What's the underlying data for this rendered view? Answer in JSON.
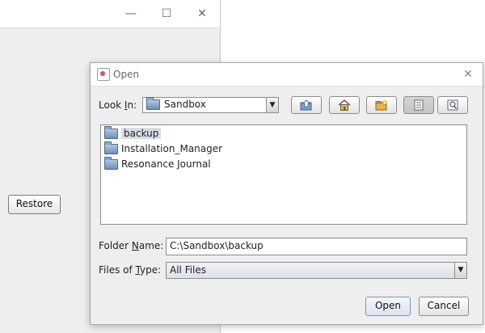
{
  "main_window": {
    "controls": {
      "minimize": "—",
      "maximize": "☐",
      "close": "✕"
    },
    "restore_label": "Restore"
  },
  "dialog": {
    "title": "Open",
    "close_glyph": "✕",
    "look_in": {
      "label_pre": "Look ",
      "label_mnemonic": "I",
      "label_post": "n:",
      "value": "Sandbox"
    },
    "toolbar": {
      "up": "up-one-level-icon",
      "home": "home-icon",
      "new_folder": "new-folder-icon",
      "list": "list-view-icon",
      "details": "details-view-icon"
    },
    "files": [
      {
        "name": "backup",
        "selected": true
      },
      {
        "name": "Installation_Manager",
        "selected": false
      },
      {
        "name": "Resonance Journal",
        "selected": false
      }
    ],
    "folder_name": {
      "label_pre": "Folder ",
      "label_mnemonic": "N",
      "label_post": "ame:",
      "value": "C:\\Sandbox\\backup"
    },
    "files_of_type": {
      "label_pre": "Files of ",
      "label_mnemonic": "T",
      "label_post": "ype:",
      "value": "All Files"
    },
    "open_label": "Open",
    "cancel_label": "Cancel"
  }
}
